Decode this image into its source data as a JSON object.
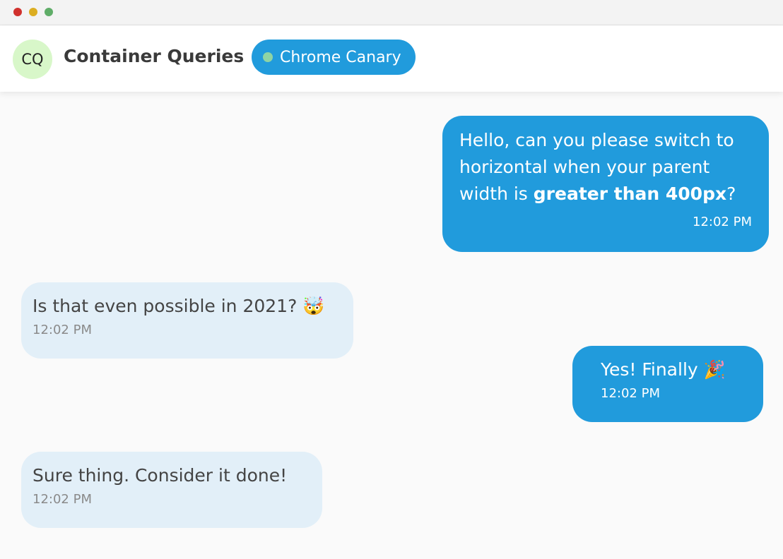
{
  "window": {
    "controls": [
      "close",
      "minimize",
      "maximize"
    ]
  },
  "header": {
    "avatar_initials": "CQ",
    "title": "Container Queries",
    "badge_label": "Chrome Canary",
    "badge_status_color": "#8ed4a4"
  },
  "colors": {
    "accent": "#219bdc",
    "incoming_bubble": "#e2eff8",
    "avatar_bg": "#d8f7c9"
  },
  "messages": [
    {
      "direction": "outgoing",
      "text_before": "Hello, can you please switch to horizontal when your parent width is ",
      "text_bold": "greater than 400px",
      "text_after": "?",
      "time": "12:02 PM"
    },
    {
      "direction": "incoming",
      "text": "Is that even possible in 2021? 🤯",
      "time": "12:02 PM"
    },
    {
      "direction": "outgoing",
      "text": "Yes! Finally 🎉",
      "time": "12:02 PM"
    },
    {
      "direction": "incoming",
      "text": "Sure thing. Consider it done!",
      "time": "12:02 PM"
    }
  ]
}
